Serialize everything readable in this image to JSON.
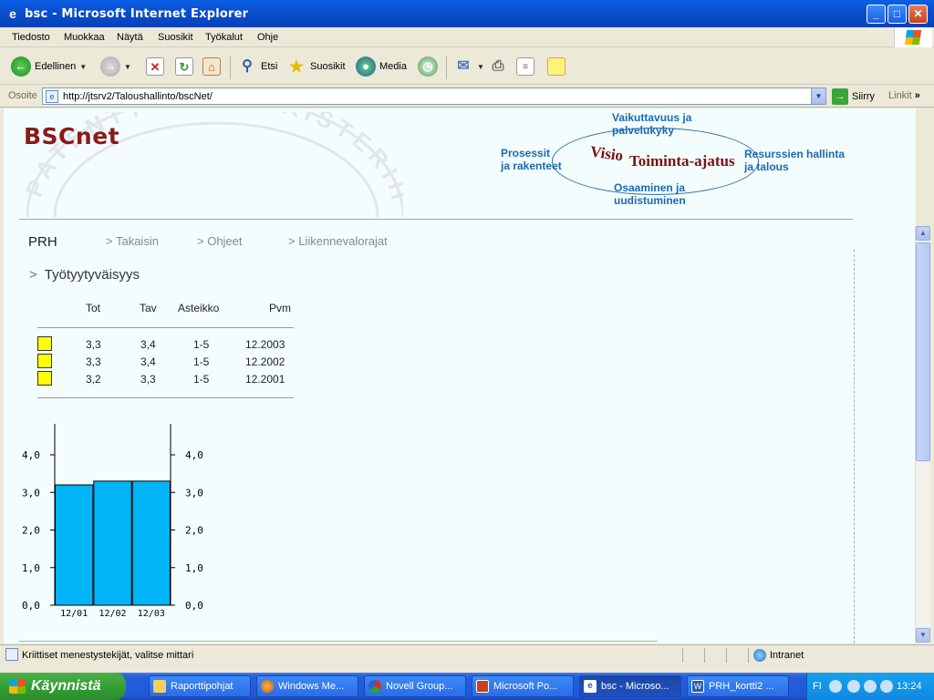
{
  "window": {
    "title": "bsc - Microsoft Internet Explorer"
  },
  "menu": [
    "Tiedosto",
    "Muokkaa",
    "Näytä",
    "Suosikit",
    "Työkalut",
    "Ohje"
  ],
  "toolbar": {
    "back": "Edellinen",
    "search": "Etsi",
    "favorites": "Suosikit",
    "media": "Media"
  },
  "address": {
    "label": "Osoite",
    "url": "http://jtsrv2/Taloushallinto/bscNet/",
    "go": "Siirry",
    "links": "Linkit"
  },
  "page": {
    "logo": "BSCnet",
    "watermark": "PATENTTI- JA REKISTERIHALLITUS",
    "perspectives": {
      "top_line1": "Vaikuttavuus ja",
      "top_line2": "palvelukyky",
      "left_line1": "Prosessit",
      "left_line2": "ja rakenteet",
      "right_line1": "Resurssien hallinta",
      "right_line2": "ja talous",
      "bottom_line1": "Osaaminen ja",
      "bottom_line2": "uudistuminen",
      "vision": "Visio",
      "mission": "Toiminta-ajatus"
    },
    "nav": {
      "home": "PRH",
      "back": "> Takaisin",
      "help": "> Ohjeet",
      "traffic": "> Liikennevalorajat"
    },
    "title_arrow": ">",
    "title": "Työtyytyväisyys",
    "table": {
      "headers": [
        "Tot",
        "Tav",
        "Asteikko",
        "Pvm"
      ],
      "rows": [
        [
          "3,3",
          "3,4",
          "1-5",
          "12.2003"
        ],
        [
          "3,3",
          "3,4",
          "1-5",
          "12.2002"
        ],
        [
          "3,2",
          "3,3",
          "1-5",
          "12.2001"
        ]
      ]
    }
  },
  "status": {
    "text": "Kriittiset menestystekijät, valitse mittari",
    "zone": "Intranet"
  },
  "taskbar": {
    "start": "Käynnistä",
    "tasks": [
      "Raporttipohjat",
      "Windows Me...",
      "Novell Group...",
      "Microsoft Po...",
      "bsc - Microso...",
      "PRH_kortti2 ..."
    ],
    "lang": "FI",
    "clock": "13:24"
  },
  "colors": {
    "bar": "#00B4F5",
    "logo": "#8B1A1A",
    "perspective": "#1C6AB0",
    "swatch": "#FFFF00"
  },
  "chart_data": {
    "type": "bar",
    "categories": [
      "12/01",
      "12/02",
      "12/03"
    ],
    "values": [
      3.2,
      3.3,
      3.3
    ],
    "ylim": [
      0,
      4.0
    ],
    "yticks": [
      "0,0",
      "1,0",
      "2,0",
      "3,0",
      "4,0"
    ],
    "ytick_values": [
      0,
      1,
      2,
      3,
      4
    ],
    "grid": false
  }
}
